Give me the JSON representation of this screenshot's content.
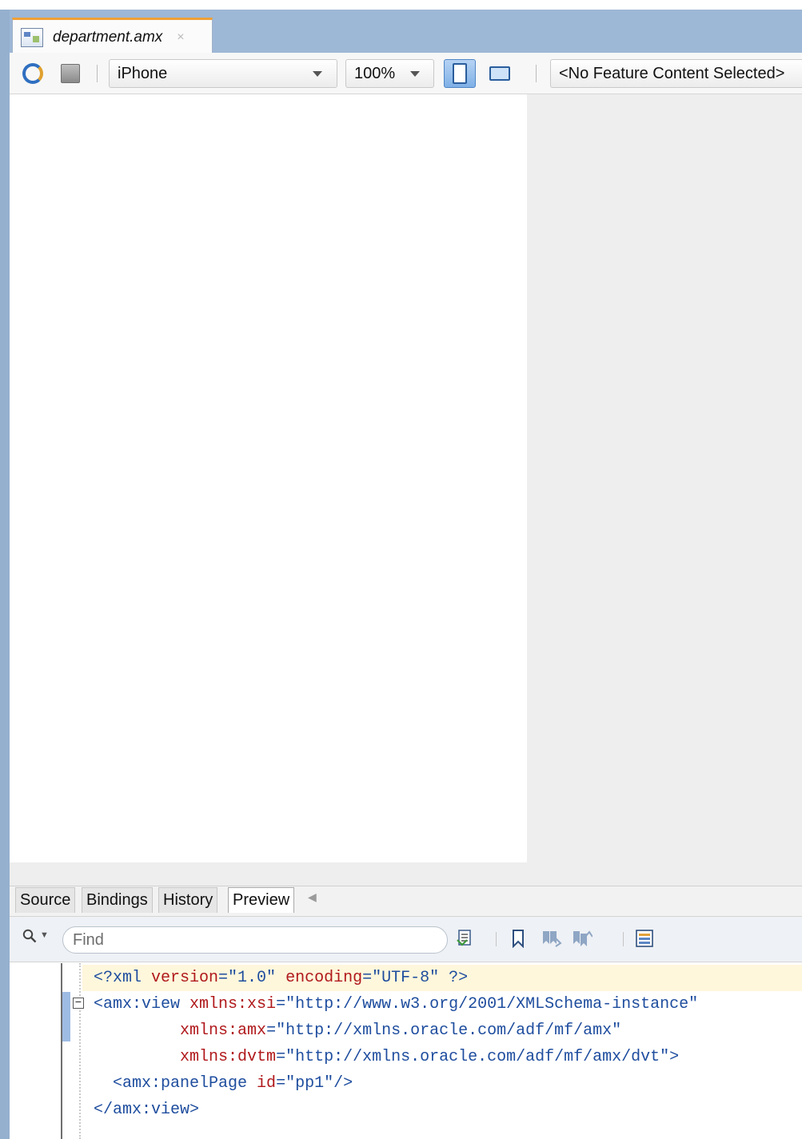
{
  "editor_tab": {
    "title": "department.amx",
    "close": "×"
  },
  "toolbar": {
    "device": "iPhone",
    "zoom": "100%",
    "feature": "<No Feature Content Selected>"
  },
  "editor_tabs": [
    "Source",
    "Bindings",
    "History",
    "Preview"
  ],
  "active_editor_tab": "Preview",
  "find": {
    "placeholder": "Find"
  },
  "code": {
    "line1": {
      "open": "<?xml ",
      "a1": "version",
      "eq1": "=",
      "v1": "\"1.0\"",
      "sp": " ",
      "a2": "encoding",
      "eq2": "=",
      "v2": "\"UTF-8\"",
      "close": " ?>"
    },
    "line2": {
      "open": "<amx:view ",
      "attr": "xmlns:xsi",
      "eq": "=",
      "val": "\"http://www.w3.org/2001/XMLSchema-instance\""
    },
    "line3": {
      "indent": "         ",
      "attr": "xmlns:amx",
      "eq": "=",
      "val": "\"http://xmlns.oracle.com/adf/mf/amx\""
    },
    "line4": {
      "indent": "         ",
      "attr": "xmlns:dvtm",
      "eq": "=",
      "val": "\"http://xmlns.oracle.com/adf/mf/amx/dvt\"",
      "close": ">"
    },
    "line5": {
      "open": "  <amx:panelPage ",
      "attr": "id",
      "eq": "=",
      "val": "\"pp1\"",
      "close": "/>"
    },
    "line6": {
      "text": "</amx:view>"
    }
  },
  "colors": {
    "tab_bar": "#9db7d6",
    "accent": "#f0a035",
    "canvas": "#ffffff",
    "design_bg": "#eeeeee"
  }
}
